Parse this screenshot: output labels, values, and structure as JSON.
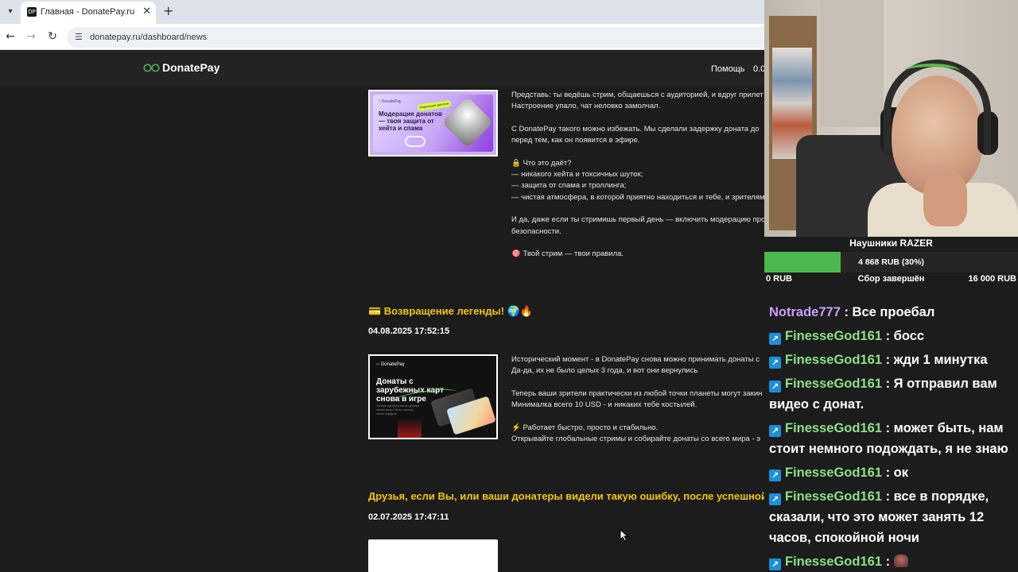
{
  "browser": {
    "tab": {
      "title": "Главная - DonatePay.ru",
      "favicon": "DP"
    },
    "url": "donatepay.ru/dashboard/news",
    "icons": {
      "tab_list": "chevron-down-icon",
      "close": "close-icon",
      "new_tab": "plus-icon",
      "back": "back-arrow-icon",
      "forward": "forward-arrow-icon",
      "reload": "reload-icon",
      "site_info": "site-info-icon"
    }
  },
  "site": {
    "logo": "DonatePay",
    "nav": {
      "help": "Помощь",
      "balance": "0.0"
    }
  },
  "news": [
    {
      "thumb": {
        "label": "/ DonatePay",
        "badge": "Модерация донатов",
        "title": "Модерация донатов — твоя защита от хейта и спама"
      },
      "lines": [
        "Представь: ты ведёшь стрим, общаешься с аудиторией, и вдруг прилет",
        "Настроение упало, чат неловко замолчал.",
        "",
        "С DonatePay такого можно избежать. Мы сделали задержку доната до",
        "перед тем, как он появится в эфире.",
        "",
        "🔒 Что это даёт?",
        "— никакого хейта и токсичных шуток;",
        "— защита от спама и троллинга;",
        "— чистая атмосфера, в которой приятно находиться и тебе, и зрителям",
        "",
        "И да, даже если ты стримишь первый день — включить модерацию про",
        "безопасности.",
        "",
        "🎯 Твой стрим — твои правила."
      ]
    },
    {
      "title": "💳 Возвращение легенды! 🌍🔥",
      "date": "04.08.2025 17:52:15",
      "thumb": {
        "logo": "DonatePay",
        "title": "Донаты с зарубежных карт снова в игре",
        "sub": "Теперь зрители из-за рубежа снова могут быть частью твоих эфиров"
      },
      "lines": [
        "Исторический момент - в DonatePay снова можно принимать донаты с",
        "Да-да, их не было целых 3 года, и вот они вернулись",
        "",
        "Теперь ваши зрители практически из любой точки планеты могут закин",
        "Минималка всего 10 USD - и никаких тебе костылей.",
        "",
        "⚡ Работает быстро, просто и стабильно.",
        "Открывайте глобальные стримы и собирайте донаты со всего мира - э"
      ]
    },
    {
      "title": "Друзья, если Вы, или ваши донатеры видели такую ошибку, после успешной",
      "date": "02.07.2025 17:47:11"
    }
  ],
  "stream": {
    "goal": {
      "title": "Наушники RAZER",
      "amount": "4 868 RUB (30%)",
      "progress": 0.3,
      "min": "0 RUB",
      "status": "Сбор завершён",
      "max": "16 000 RUB"
    },
    "chat": [
      {
        "user": "Notrade777",
        "text": "Все проебал",
        "color": "#c9a0ff",
        "badge": false
      },
      {
        "user": "FinesseGod161",
        "text": "босс",
        "color": "#8de08a",
        "badge": true
      },
      {
        "user": "FinesseGod161",
        "text": "жди 1 минутка",
        "color": "#8de08a",
        "badge": true
      },
      {
        "user": "FinesseGod161",
        "text": "Я отправил вам видео с донат.",
        "color": "#8de08a",
        "badge": true
      },
      {
        "user": "FinesseGod161",
        "text": "может быть, нам стоит немного подождать, я не знаю",
        "color": "#8de08a",
        "badge": true
      },
      {
        "user": "FinesseGod161",
        "text": "ок",
        "color": "#8de08a",
        "badge": true
      },
      {
        "user": "FinesseGod161",
        "text": "все в порядке, сказали, что это может занять 12 часов, спокойной ночи",
        "color": "#8de08a",
        "badge": true
      },
      {
        "user": "FinesseGod161",
        "text": "",
        "color": "#8de08a",
        "badge": true,
        "emote": "emote-icon"
      }
    ]
  }
}
